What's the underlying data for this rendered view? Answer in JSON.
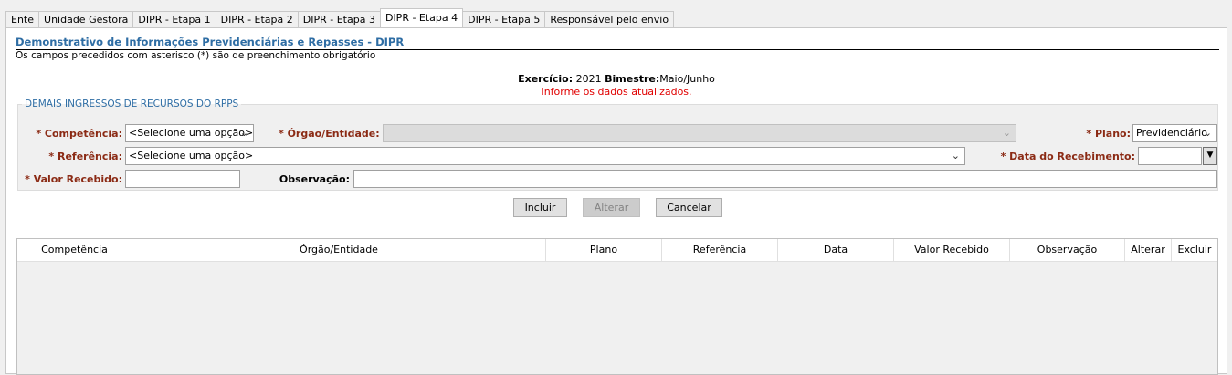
{
  "tabs": [
    "Ente",
    "Unidade Gestora",
    "DIPR - Etapa 1",
    "DIPR - Etapa 2",
    "DIPR - Etapa 3",
    "DIPR - Etapa 4",
    "DIPR - Etapa 5",
    "Responsável pelo envio"
  ],
  "active_tab": "DIPR - Etapa 4",
  "page": {
    "title": "Demonstrativo de Informações Previdenciárias e Repasses - DIPR",
    "hint": "Os campos precedidos com asterisco (*) são de preenchimento obrigatório",
    "exercicio_label": "Exercício:",
    "exercicio_value": "2021",
    "bimestre_label": "Bimestre:",
    "bimestre_value": "Maio/Junho",
    "alert": "Informe os dados atualizados."
  },
  "form": {
    "legend": "DEMAIS INGRESSOS DE RECURSOS DO RPPS",
    "competencia_label": "* Competência:",
    "competencia_value": "<Selecione uma opção>",
    "orgao_label": "* Órgão/Entidade:",
    "orgao_value": "",
    "plano_label": "* Plano:",
    "plano_value": "Previdenciário",
    "referencia_label": "* Referência:",
    "referencia_value": "<Selecione uma opção>",
    "data_label": "* Data do Recebimento:",
    "data_value": "",
    "valor_label": "* Valor Recebido:",
    "valor_value": "",
    "observacao_label": "Observação:",
    "observacao_value": ""
  },
  "buttons": {
    "incluir": "Incluir",
    "alterar": "Alterar",
    "cancelar": "Cancelar"
  },
  "table": {
    "columns": [
      "Competência",
      "Órgão/Entidade",
      "Plano",
      "Referência",
      "Data",
      "Valor Recebido",
      "Observação",
      "Alterar",
      "Excluir"
    ],
    "rows": []
  },
  "icons": {
    "dropdown": "chevron-down-icon",
    "calendar": "calendar-dropdown-icon"
  }
}
